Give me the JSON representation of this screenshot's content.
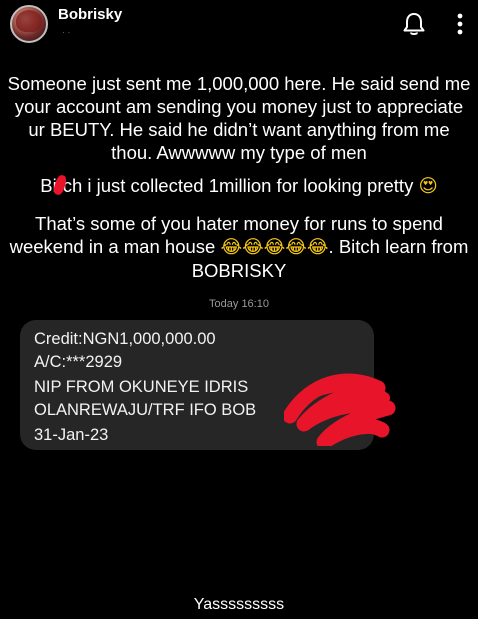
{
  "header": {
    "username": "Bobrisky",
    "subtitle": "· ·"
  },
  "caption": {
    "line1": "Someone just sent me 1,000,000 here. He said send me your account am sending you money just to appreciate ur BEUTY. He said he didn’t want anything from me thou. Awwwww my type of men",
    "line2_prefix": "Bi",
    "line2_suffix": "ch i just collected 1million for looking pretty ",
    "line2_emoji": "😍",
    "line3_prefix": "That’s some of you hater money for runs to spend weekend in a man house ",
    "line3_emoji": "😂😂😂😂😂",
    "line3_suffix": ". Bitch learn from BOBRISKY"
  },
  "message": {
    "timestamp": "Today 16:10",
    "lines": [
      "Credit:NGN1,000,000.00",
      "A/C:***2929",
      "NIP FROM OKUNEYE IDRIS",
      "OLANREWAJU/TRF IFO BOB",
      "31-Jan-23"
    ]
  },
  "footer": {
    "text": "Yasssssssss"
  },
  "icons": {
    "bell": "bell-icon",
    "more": "more-vertical-icon"
  },
  "colors": {
    "background": "#000000",
    "bubble": "#262626",
    "redaction": "#e8142a"
  }
}
